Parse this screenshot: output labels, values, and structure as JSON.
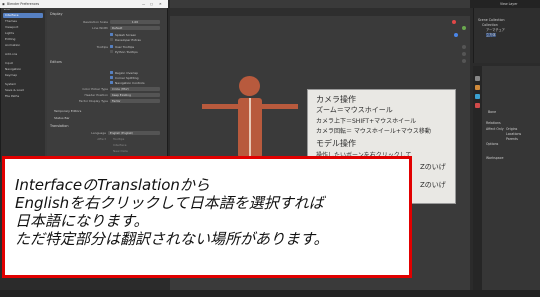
{
  "prefs": {
    "window_title": "Blender Preferences",
    "menu": [
      "Edit"
    ],
    "sidebar": [
      {
        "label": "Interface",
        "active": true
      },
      {
        "label": "Themes",
        "active": false
      },
      {
        "label": "Viewport",
        "active": false
      },
      {
        "label": "Lights",
        "active": false
      },
      {
        "label": "Editing",
        "active": false
      },
      {
        "label": "Animation",
        "active": false
      },
      {
        "label": "Add-ons",
        "active": false
      },
      {
        "label": "Input",
        "active": false
      },
      {
        "label": "Navigation",
        "active": false
      },
      {
        "label": "Keymap",
        "active": false
      },
      {
        "label": "System",
        "active": false
      },
      {
        "label": "Save & Load",
        "active": false
      },
      {
        "label": "File Paths",
        "active": false
      }
    ],
    "sections": {
      "display": "Display",
      "editors": "Editors",
      "temporary_editors": "Temporary Editors",
      "status_bar": "Status Bar",
      "translation": "Translation"
    },
    "display": {
      "resolution_scale_label": "Resolution Scale",
      "resolution_scale_value": "1.00",
      "line_width_label": "Line Width",
      "line_width_value": "Default",
      "splash_screen": "Splash Screen",
      "developer_extras": "Developer Extras",
      "tooltips_label": "Tooltips",
      "user_tooltips": "User Tooltips",
      "python_tooltips": "Python Tooltips"
    },
    "editors": {
      "region_overlap": "Region Overlap",
      "corner_splitting": "Corner Splitting",
      "navigation_controls": "Navigation Controls",
      "color_picker_label": "Color Picker Type",
      "color_picker_value": "Circle (HSV)",
      "header_position_label": "Header Position",
      "header_position_value": "Keep Existing",
      "factor_display_label": "Factor Display Type",
      "factor_display_value": "Factor"
    },
    "translation": {
      "language_label": "Language",
      "language_value": "English (English)",
      "affect_label": "Affect",
      "tooltips": "Tooltips",
      "interface": "Interface",
      "new_data": "New Data"
    }
  },
  "topbar": {
    "menus": [
      "Object",
      "View",
      "Select",
      "Add",
      "Object"
    ],
    "scene": "Scene",
    "view_layer": "View Layer"
  },
  "outliner": {
    "title": "Scene Collection",
    "items": [
      "Collection",
      "アーマチュア",
      "立方体"
    ]
  },
  "props": {
    "object_name": "Bone",
    "labels": [
      "Relations",
      "Affect Only",
      "Origins",
      "Locations",
      "Parents",
      "Options",
      "Workspace"
    ]
  },
  "whiteboard": {
    "lines": [
      {
        "text": "カメラ操作",
        "red": false
      },
      {
        "text": "ズーム＝マウスホイール",
        "red": false
      },
      {
        "text": "カメラ上下＝SHIFT+マウスホイール",
        "red": false
      },
      {
        "text": "カメラ回転＝ マウスホイール+マウス移動",
        "red": false
      },
      {
        "text": "モデル操作",
        "red": false
      },
      {
        "text": "操作したいボーンを右クリックして",
        "red": false
      },
      {
        "text": "Zのいげ",
        "red": false
      },
      {
        "text": "Zのいげ",
        "red": false
      }
    ]
  },
  "subtitle": {
    "lines": [
      "InterfaceのTranslationから",
      "Englishを右クリックして日本語を選択すれば",
      "日本語になります。",
      "ただ特定部分は翻訳されない場所があります。"
    ]
  },
  "colors": {
    "accent": "#5680c2",
    "subtitle_border": "#e10000",
    "mannequin": "#b85a3d"
  }
}
